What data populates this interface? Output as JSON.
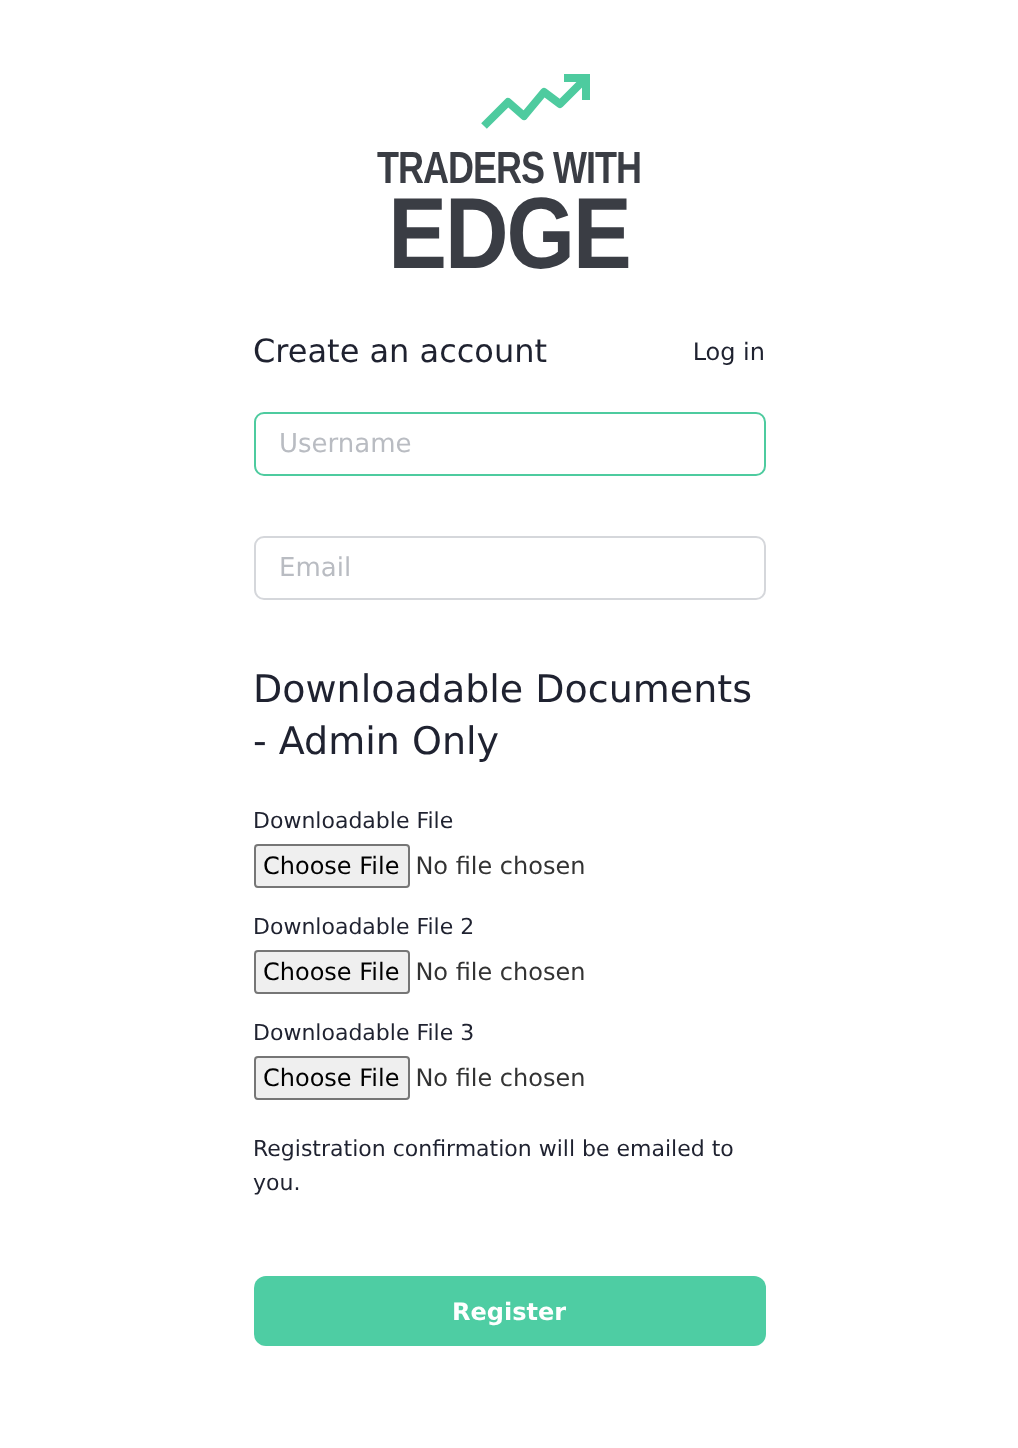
{
  "logo": {
    "line_1": "TRADERS WITH",
    "line_2": "EDGE"
  },
  "header": {
    "title": "Create an account",
    "login_link": "Log in"
  },
  "fields": [
    {
      "placeholder": "Username",
      "focused": true
    },
    {
      "placeholder": "Email",
      "focused": false
    }
  ],
  "documents": {
    "title": "Downloadable Documents - Admin Only",
    "files": [
      {
        "label": "Downloadable File",
        "button": "Choose File",
        "status": "No file chosen"
      },
      {
        "label": "Downloadable File 2",
        "button": "Choose File",
        "status": "No file chosen"
      },
      {
        "label": "Downloadable File 3",
        "button": "Choose File",
        "status": "No file chosen"
      }
    ]
  },
  "note": "Registration confirmation will be emailed to you.",
  "submit": "Register"
}
